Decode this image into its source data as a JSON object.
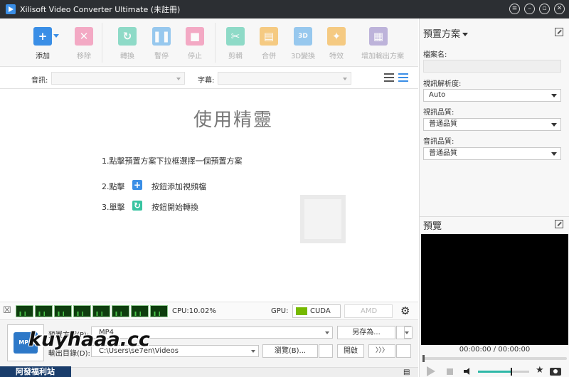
{
  "window": {
    "title": "Xilisoft Video Converter Ultimate (未註冊)"
  },
  "toolbar": {
    "items": [
      {
        "label": "添加",
        "icon": "add-icon",
        "color": "#3a8ee6"
      },
      {
        "label": "移除",
        "icon": "remove-icon",
        "color": "#f06a9b"
      },
      {
        "label": "轉換",
        "icon": "convert-icon",
        "color": "#39c4a1"
      },
      {
        "label": "暫停",
        "icon": "pause-icon",
        "color": "#4aa3e8"
      },
      {
        "label": "停止",
        "icon": "stop-icon",
        "color": "#f06a9b"
      },
      {
        "label": "剪輯",
        "icon": "clip-icon",
        "color": "#39c4a1"
      },
      {
        "label": "合併",
        "icon": "merge-icon",
        "color": "#f5a623"
      },
      {
        "label": "3D變換",
        "icon": "3d-icon",
        "color": "#4aa3e8"
      },
      {
        "label": "特效",
        "icon": "effects-icon",
        "color": "#f5a623"
      },
      {
        "label": "增加輸出方案",
        "icon": "add-profile-icon",
        "color": "#8e7cc3"
      }
    ]
  },
  "subbar": {
    "audio_label": "音訊:",
    "subtitle_label": "字幕:"
  },
  "wizard": {
    "title": "使用精靈",
    "step1": "1.點擊預置方案下拉框選擇一個預置方案",
    "step2_prefix": "2.點擊",
    "step2_suffix": "按鈕添加視頻檔",
    "step3_prefix": "3.單擊",
    "step3_suffix": "按鈕開始轉換"
  },
  "gpu": {
    "cpu_text": "CPU:10.02%",
    "gpu_label": "GPU:",
    "cuda": "CUDA",
    "amd": "AMD APP"
  },
  "output": {
    "profile_label": "預置方案(P):",
    "profile_value": "MP4",
    "save_as": "另存為...",
    "dest_label": "輸出目錄(D):",
    "dest_value": "C:\\Users\\se7en\\Videos",
    "browse": "瀏覽(B)...",
    "open": "開啟",
    "convert_arrows": "〉〉〉"
  },
  "watermark": {
    "text": "kuyhaaa.cc",
    "logo_text": "阿發福利站"
  },
  "profile_panel": {
    "title": "預置方案",
    "file_name_label": "檔案名:",
    "file_name_value": "",
    "resolution_label": "視訊解析度:",
    "resolution_value": "Auto",
    "video_quality_label": "視訊品質:",
    "video_quality_value": "普通品質",
    "audio_quality_label": "音訊品質:",
    "audio_quality_value": "普通品質"
  },
  "preview": {
    "title": "預覽",
    "time": "00:00:00 / 00:00:00",
    "volume": 0.65
  }
}
